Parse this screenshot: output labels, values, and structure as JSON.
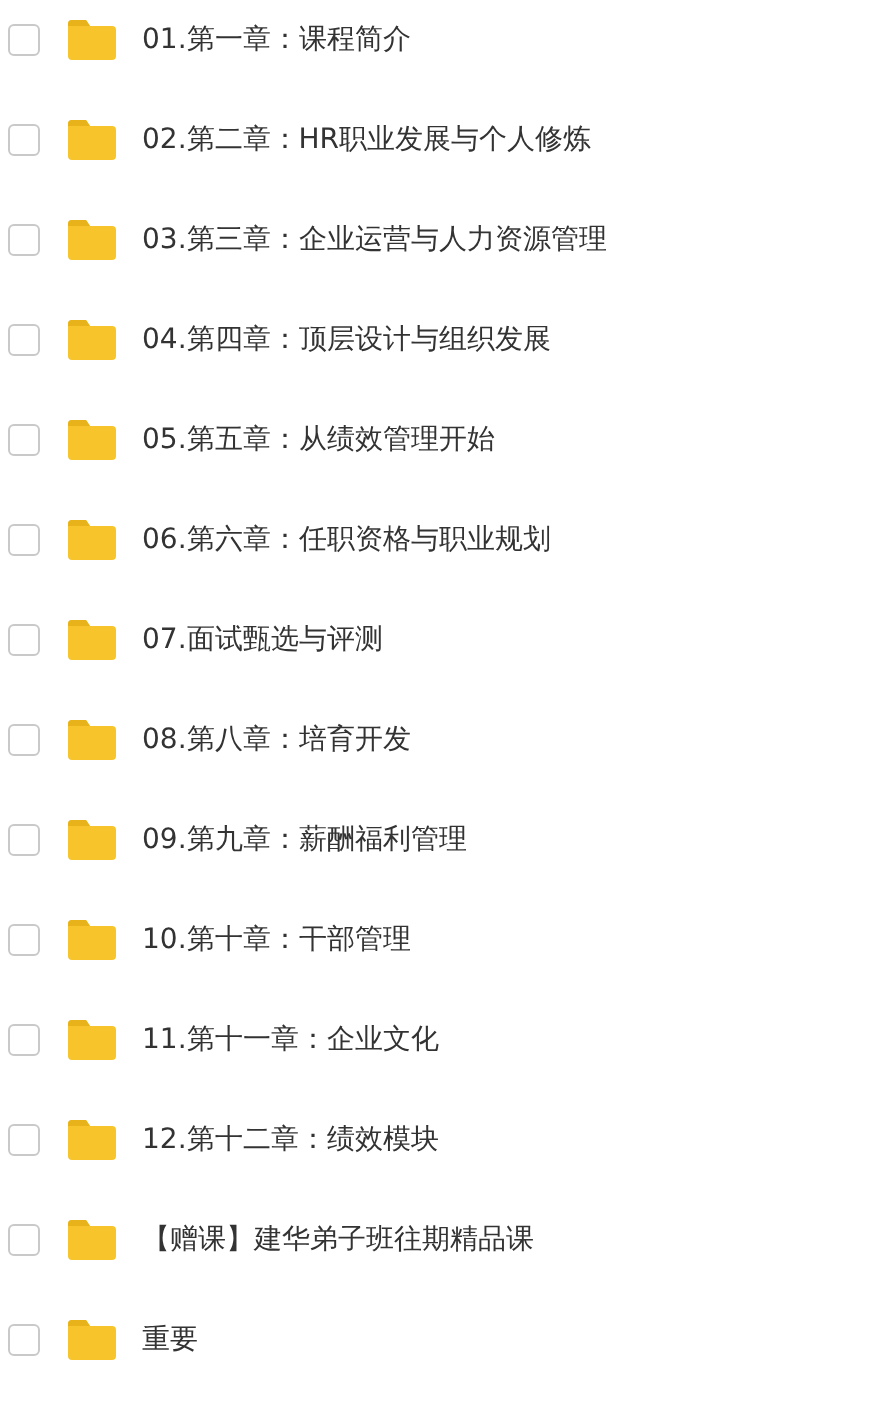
{
  "items": [
    {
      "name": "01.第一章：课程简介",
      "checked": false
    },
    {
      "name": "02.第二章：HR职业发展与个人修炼",
      "checked": false
    },
    {
      "name": "03.第三章：企业运营与人力资源管理",
      "checked": false
    },
    {
      "name": "04.第四章：顶层设计与组织发展",
      "checked": false
    },
    {
      "name": "05.第五章：从绩效管理开始",
      "checked": false
    },
    {
      "name": "06.第六章：任职资格与职业规划",
      "checked": false
    },
    {
      "name": "07.面试甄选与评测",
      "checked": false
    },
    {
      "name": "08.第八章：培育开发",
      "checked": false
    },
    {
      "name": "09.第九章：薪酬福利管理",
      "checked": false
    },
    {
      "name": "10.第十章：干部管理",
      "checked": false
    },
    {
      "name": "11.第十一章：企业文化",
      "checked": false
    },
    {
      "name": "12.第十二章：绩效模块",
      "checked": false
    },
    {
      "name": "【赠课】建华弟子班往期精品课",
      "checked": false
    },
    {
      "name": "重要",
      "checked": false
    }
  ]
}
